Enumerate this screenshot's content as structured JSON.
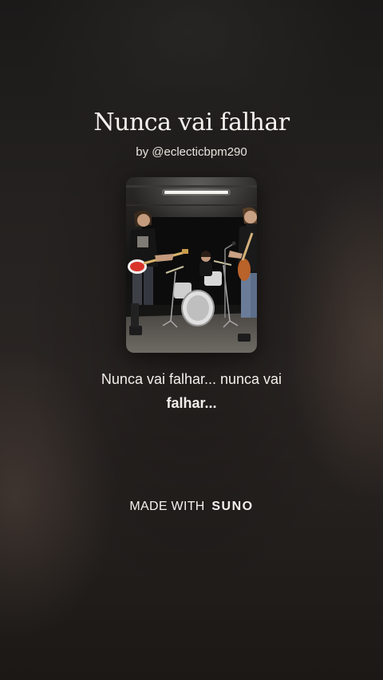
{
  "song": {
    "title": "Nunca vai falhar",
    "author": "by @eclecticbpm290"
  },
  "cover_art": {
    "icon": "band-photo",
    "alt": "Rock band rehearsing: two guitarists and a drummer"
  },
  "lyrics": {
    "line1": "Nunca vai falhar... nunca vai",
    "line2": "falhar..."
  },
  "footer": {
    "made_with": "MADE WITH",
    "brand": "SUNO"
  },
  "colors": {
    "background": "#242120",
    "text": "#f5f2ee"
  }
}
